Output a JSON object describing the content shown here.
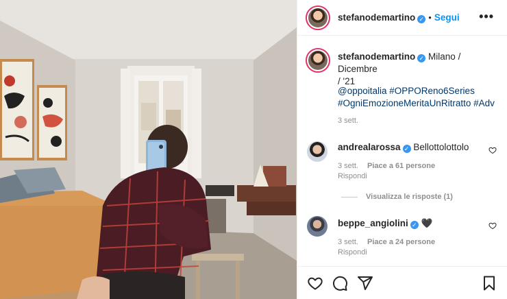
{
  "post": {
    "username": "stefanodemartino",
    "follow_label": "Segui",
    "more_label": "•••"
  },
  "caption": {
    "username": "stefanodemartino",
    "location_line1": "Milano / Dicembre",
    "location_line2": "/ '21",
    "tags_line1": "@oppoitalia #OPPOReno6Series",
    "tags_line2": "#OgniEmozioneMeritaUnRitratto #Adv",
    "time": "3 sett."
  },
  "comments": [
    {
      "username": "andrealarossa",
      "text": "Bellottolottolo",
      "time": "3 sett.",
      "likes": "Piace a 61 persone",
      "reply": "Rispondi",
      "view_replies": "Visualizza le risposte (1)"
    },
    {
      "username": "beppe_angiolini",
      "text": "🖤",
      "time": "3 sett.",
      "likes": "Piace a 24 persone",
      "reply": "Rispondi"
    }
  ],
  "colors": {
    "link": "#0095f6",
    "hashtag": "#00376b",
    "verified": "#3897f0",
    "muted": "#8e8e8e"
  },
  "icons": [
    "heart-icon",
    "comment-icon",
    "share-icon",
    "bookmark-icon",
    "verified-badge-icon"
  ]
}
